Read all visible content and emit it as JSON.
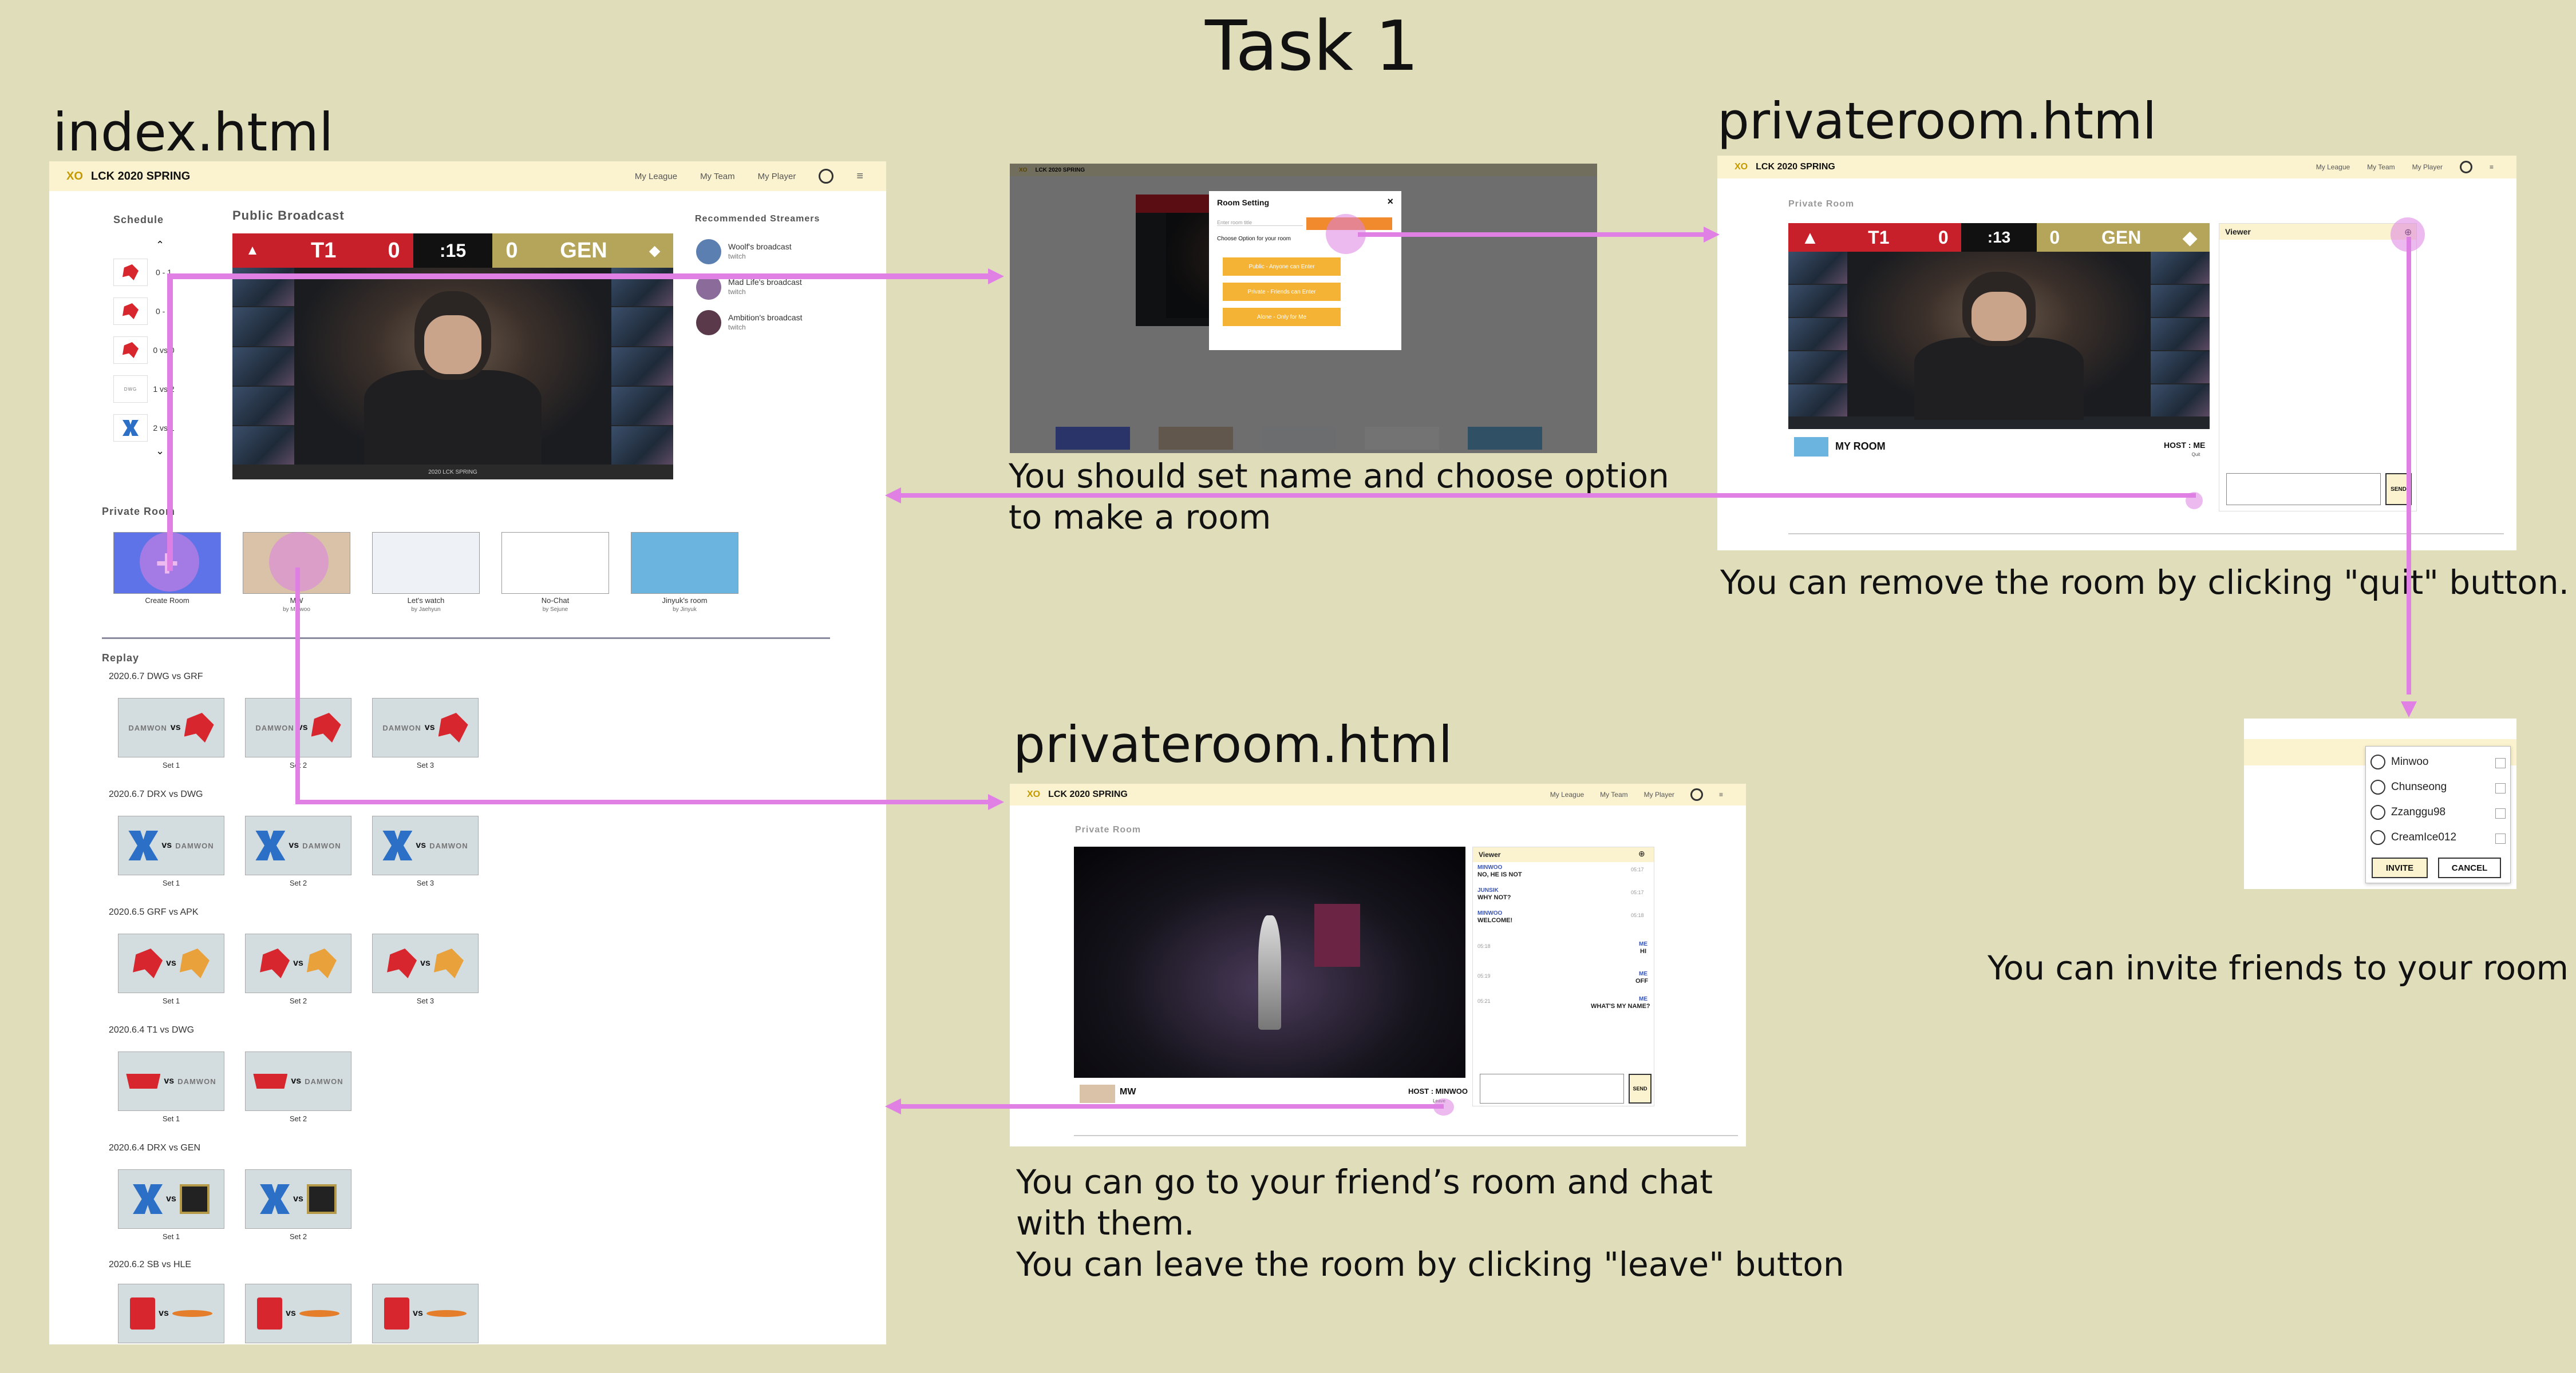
{
  "figure": {
    "title": "Task 1",
    "captions": {
      "index_label": "index.html",
      "private_top_label": "privateroom.html",
      "private_bottom_label": "privateroom.html",
      "set_name": "You should set name and choose option to make a room",
      "remove_room": "You can remove the room by clicking \"quit\" button.",
      "invite_friends": "You can invite friends to your room",
      "friend_room": "You can go to your friend’s room and chat with them.",
      "leave_room": "You can leave the room by clicking \"leave\" button"
    }
  },
  "app": {
    "brand_mark": "XO",
    "brand_name": "LCK 2020 SPRING",
    "nav": [
      "My League",
      "My Team",
      "My Player"
    ]
  },
  "index": {
    "schedule_title": "Schedule",
    "schedule": [
      {
        "score": "0 - 1"
      },
      {
        "score": "0 - 1"
      },
      {
        "score": "0 vs 0"
      },
      {
        "score": "1 vs 2"
      },
      {
        "score": "2 vs 1"
      }
    ],
    "broadcast_title": "Public Broadcast",
    "broadcast": {
      "team_left": "T1",
      "score_left": "0",
      "timer": ":15",
      "score_right": "0",
      "team_right": "GEN",
      "footer": "2020 LCK SPRING"
    },
    "streamers_title": "Recommended Streamers",
    "streamers": [
      {
        "name": "Woolf's broadcast",
        "platform": "twitch"
      },
      {
        "name": "Mad Life's broadcast",
        "platform": "twitch"
      },
      {
        "name": "Ambition's broadcast",
        "platform": "twitch"
      }
    ],
    "private_title": "Private Room",
    "rooms": [
      {
        "title": "Create Room",
        "by": ""
      },
      {
        "title": "MW",
        "by": "by Minwoo"
      },
      {
        "title": "Let's watch",
        "by": "by Jaehyun"
      },
      {
        "title": "No-Chat",
        "by": "by Sejune"
      },
      {
        "title": "Jinyuk's room",
        "by": "by Jinyuk"
      }
    ],
    "replay_title": "Replay",
    "replays": [
      {
        "date": "2020.6.7 DWG vs GRF",
        "sets": [
          "Set 1",
          "Set 2",
          "Set 3"
        ],
        "left": "dwg",
        "right": "grf"
      },
      {
        "date": "2020.6.7 DRX vs DWG",
        "sets": [
          "Set 1",
          "Set 2",
          "Set 3"
        ],
        "left": "drx",
        "right": "dwg"
      },
      {
        "date": "2020.6.5 GRF vs APK",
        "sets": [
          "Set 1",
          "Set 2",
          "Set 3"
        ],
        "left": "grf",
        "right": "apk"
      },
      {
        "date": "2020.6.4 T1 vs DWG",
        "sets": [
          "Set 1",
          "Set 2"
        ],
        "left": "t1",
        "right": "dwg"
      },
      {
        "date": "2020.6.4 DRX vs GEN",
        "sets": [
          "Set 1",
          "Set 2"
        ],
        "left": "drx",
        "right": "gen"
      },
      {
        "date": "2020.6.2 SB vs HLE",
        "sets": [
          "Set 1",
          "Set 2",
          "Set 3"
        ],
        "left": "sb",
        "right": "hle"
      }
    ],
    "vs": "vs",
    "dwg_text": "DAMWON",
    "grf_text": "GRIFFIN"
  },
  "modal": {
    "title": "Room Setting",
    "close": "×",
    "name_placeholder": "Enter room title",
    "choose": "Choose Option for your room",
    "options": [
      "Public - Anyone can Enter",
      "Private - Friends can Enter",
      "Alone - Only for Me"
    ]
  },
  "private_top": {
    "section_title": "Private Room",
    "viewer_title": "Viewer",
    "room_name": "MY ROOM",
    "host": "HOST : ME",
    "timer": ":13",
    "team_left": "T1",
    "team_right": "GEN",
    "send": "SEND",
    "quit": "Quit"
  },
  "invite": {
    "friends": [
      "Minwoo",
      "Chunseong",
      "Zzanggu98",
      "CreamIce012"
    ],
    "invite_btn": "INVITE",
    "cancel_btn": "CANCEL"
  },
  "private_bottom": {
    "section_title": "Private Room",
    "viewer_title": "Viewer",
    "room_name": "MW",
    "host": "HOST : MINWOO",
    "send": "SEND",
    "leave": "Leave",
    "chat": [
      {
        "name": "MINWOO",
        "text": "NO, HE IS NOT",
        "time": "05:17"
      },
      {
        "name": "JUNSIK",
        "text": "WHY NOT?",
        "time": "05:17"
      },
      {
        "name": "MINWOO",
        "text": "WELCOME!",
        "time": "05:18"
      },
      {
        "name": "ME",
        "text": "HI",
        "time": "05:18"
      },
      {
        "name": "ME",
        "text": "OFF",
        "time": "05:19"
      },
      {
        "name": "ME",
        "text": "WHAT'S MY NAME?",
        "time": "05:21"
      }
    ]
  },
  "colors": {
    "background": "#e0ddbb",
    "accent_yellow": "#fbf3cf",
    "arrow": "#e07fe4",
    "option_orange": "#f5b335",
    "t1_red": "#c8202a",
    "gen_gold": "#b5a55a"
  }
}
